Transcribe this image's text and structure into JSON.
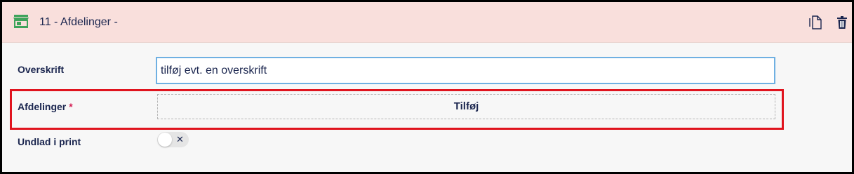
{
  "header": {
    "title": "11 - Afdelinger -",
    "colors": {
      "background": "#f9dfdc",
      "icon": "#3ea35b"
    }
  },
  "fields": {
    "overskrift": {
      "label": "Overskrift",
      "value": "tilføj evt. en overskrift"
    },
    "afdelinger": {
      "label": "Afdelinger",
      "required_mark": "*",
      "add_button": "Tilføj"
    },
    "undlad_i_print": {
      "label": "Undlad i print",
      "toggle_state": "off",
      "toggle_glyph": "✕"
    }
  },
  "icons": {
    "header_left": "store-icon",
    "copy": "copy-icon",
    "delete": "trash-icon"
  }
}
